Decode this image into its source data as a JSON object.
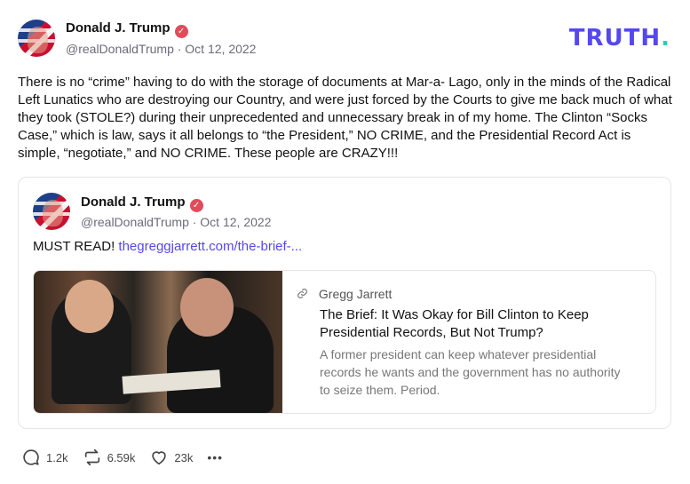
{
  "post": {
    "author_name": "Donald J. Trump",
    "handle": "@realDonaldTrump",
    "date": "Oct 12, 2022",
    "meta": "@realDonaldTrump · Oct 12, 2022",
    "text": "There is no “crime” having to do with the storage of documents at Mar-a- Lago, only in the minds of the Radical Left Lunatics who are destroying our Country, and were just forced by the Courts to give me back much of what they took (STOLE?) during their unprecedented and unnecessary break in of my home. The Clinton “Socks Case,” which is law, says it all belongs to “the President,” NO CRIME, and the Presidential Record Act is simple, “negotiate,” and NO CRIME. These people are CRAZY!!!"
  },
  "brand": {
    "logo_text": "TRUTH",
    "logo_dot": ".",
    "logo_color": "#5448ee",
    "dot_color": "#20d0b0"
  },
  "quote": {
    "author_name": "Donald J. Trump",
    "meta": "@realDonaldTrump · Oct 12, 2022",
    "text_prefix": "MUST READ! ",
    "link_text": "thegreggjarrett.com/the-brief-...",
    "link_card": {
      "source": "Gregg Jarrett",
      "title": "The Brief: It Was Okay for Bill Clinton to Keep Presidential Records, But Not Trump?",
      "description": "A former president can keep whatever presidential records he wants and the government has no authority to seize them.  Period."
    }
  },
  "actions": {
    "replies": "1.2k",
    "retruths": "6.59k",
    "likes": "23k",
    "more": "•••"
  },
  "colors": {
    "verified": "#e14b5a",
    "link": "#5448ee"
  }
}
